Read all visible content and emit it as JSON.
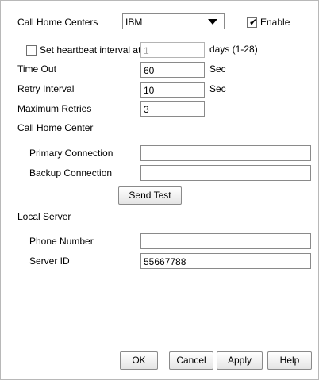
{
  "call_home_centers": {
    "label": "Call Home Centers",
    "selected": "IBM",
    "enable_label": "Enable",
    "enable_checked": true
  },
  "heartbeat": {
    "label": "Set heartbeat interval at",
    "value": "1",
    "unit": "days (1-28)",
    "checked": false
  },
  "timeout": {
    "label": "Time Out",
    "value": "60",
    "unit": "Sec"
  },
  "retry_interval": {
    "label": "Retry Interval",
    "value": "10",
    "unit": "Sec"
  },
  "max_retries": {
    "label": "Maximum Retries",
    "value": "3"
  },
  "call_home_center": {
    "section_label": "Call Home Center",
    "primary_label": "Primary Connection",
    "primary_value": "",
    "backup_label": "Backup Connection",
    "backup_value": "",
    "send_test": "Send Test"
  },
  "local_server": {
    "section_label": "Local Server",
    "phone_label": "Phone Number",
    "phone_value": "",
    "server_id_label": "Server ID",
    "server_id_value": "55667788"
  },
  "buttons": {
    "ok": "OK",
    "cancel": "Cancel",
    "apply": "Apply",
    "help": "Help"
  }
}
